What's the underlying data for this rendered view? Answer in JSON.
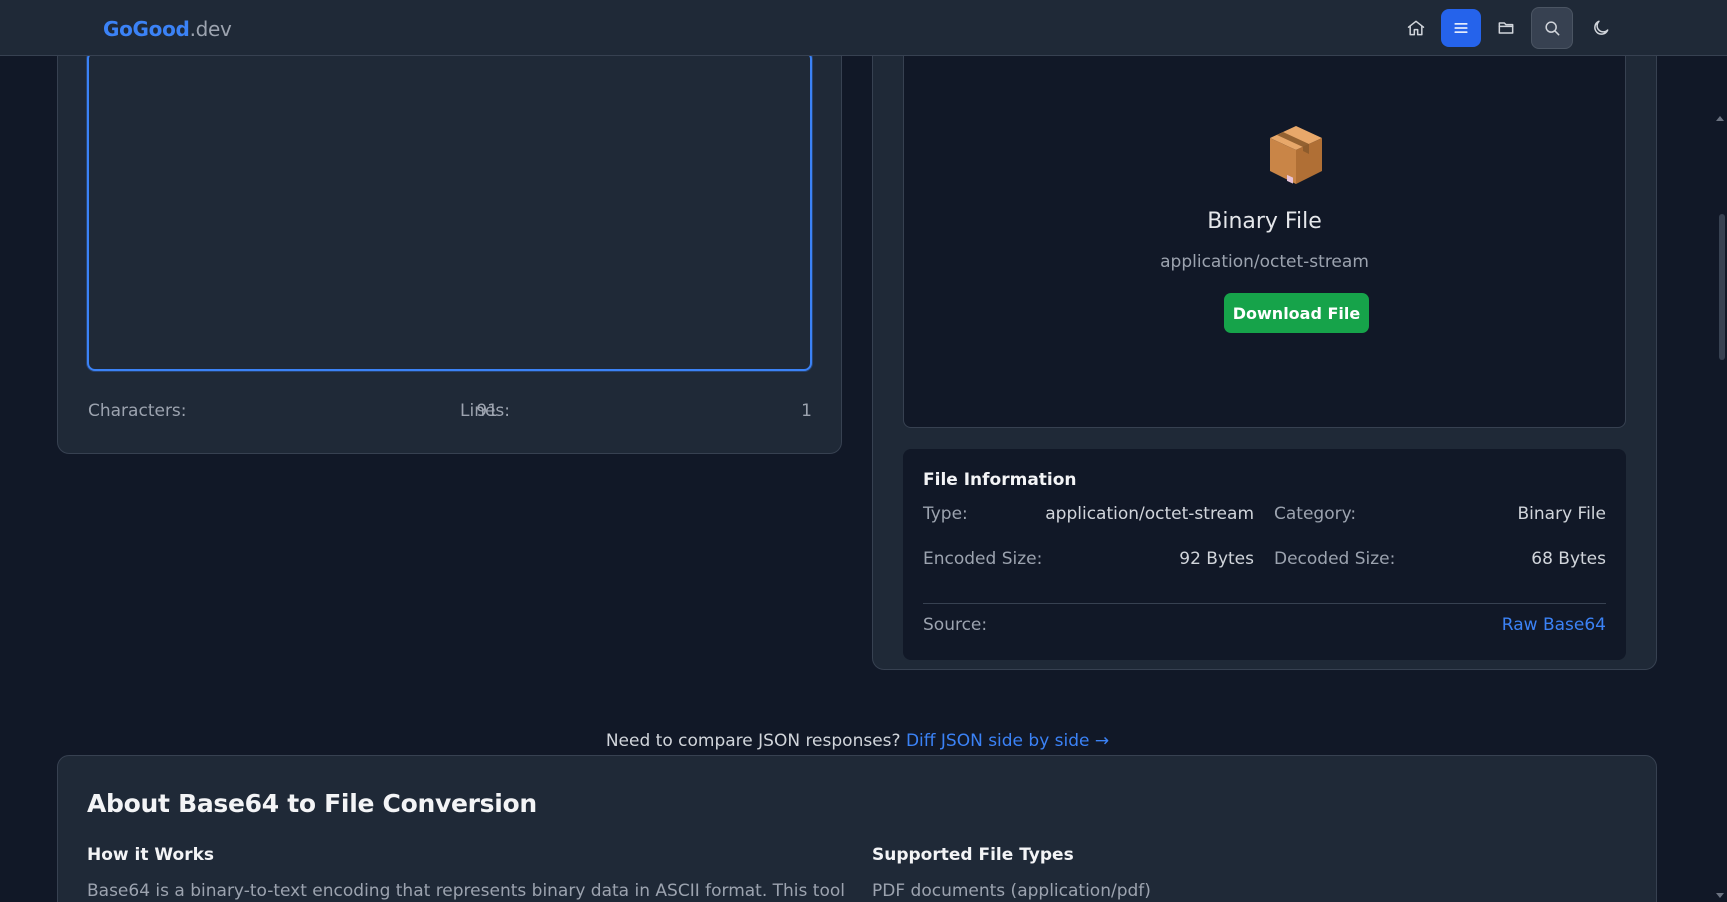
{
  "header": {
    "brand": "GoGood",
    "tld": ".dev",
    "nav_icons": [
      "home-icon",
      "menu-icon",
      "folder-icon",
      "search-icon",
      "moon-icon"
    ]
  },
  "input_panel": {
    "characters_label": "Characters:",
    "characters_value": "91",
    "lines_label": "Lines:",
    "lines_value": "1"
  },
  "preview": {
    "icon": "package-icon",
    "title": "Binary File",
    "mime": "application/octet-stream",
    "download_label": "Download File"
  },
  "file_info": {
    "title": "File Information",
    "type_label": "Type:",
    "type_value": "application/octet-stream",
    "category_label": "Category:",
    "category_value": "Binary File",
    "encoded_label": "Encoded Size:",
    "encoded_value": "92 Bytes",
    "decoded_label": "Decoded Size:",
    "decoded_value": "68 Bytes",
    "source_label": "Source:",
    "source_value": "Raw Base64"
  },
  "promo": {
    "text": "Need to compare JSON responses?",
    "link": "Diff JSON side by side →"
  },
  "about": {
    "title": "About Base64 to File Conversion",
    "how_title": "How it Works",
    "how_text": "Base64 is a binary-to-text encoding that represents binary data in ASCII format. This tool",
    "types_title": "Supported File Types",
    "types_first": "PDF documents (application/pdf)"
  },
  "colors": {
    "background": "#111827",
    "panel": "#1f2937",
    "accent": "#3b82f6",
    "download": "#16a34a"
  }
}
